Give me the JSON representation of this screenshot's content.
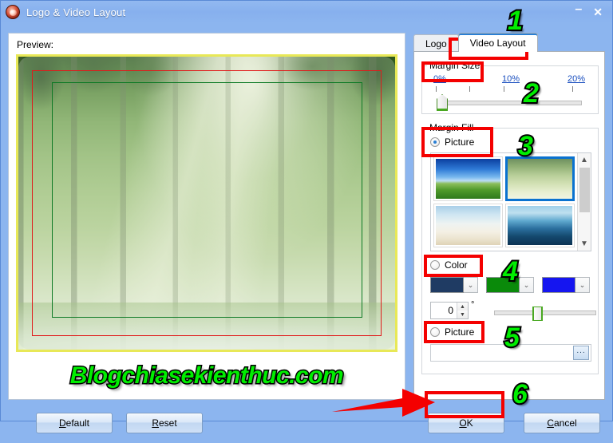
{
  "window": {
    "title": "Logo & Video Layout",
    "icon": "app-icon",
    "minimize_label": "–",
    "close_label": "✕"
  },
  "preview": {
    "label": "Preview:",
    "watermark": "Blogchiasekienthuc.com",
    "border_color": "#e8e857",
    "red_rect_color": "#e01b1b",
    "green_rect_color": "#0d7a25"
  },
  "tabs": [
    {
      "label": "Logo",
      "active": false
    },
    {
      "label": "Video Layout",
      "active": true
    }
  ],
  "margin_size": {
    "legend": "Margin Size",
    "ticks": [
      "0%",
      "10%",
      "20%"
    ],
    "value": "0%"
  },
  "margin_fill": {
    "legend": "Margin Fill",
    "picture_radio_top": {
      "label": "Picture",
      "checked": true
    },
    "thumbnails": [
      {
        "name": "bliss-landscape",
        "selected": false
      },
      {
        "name": "forest-light-rays",
        "selected": true
      },
      {
        "name": "white-beach",
        "selected": false
      },
      {
        "name": "ocean-palm-shadow",
        "selected": false
      }
    ],
    "scrollbar": {
      "up": "▲",
      "down": "▼"
    },
    "color_radio": {
      "label": "Color",
      "checked": false
    },
    "color_swatches": [
      {
        "name": "color-1",
        "hex": "#1f3b63",
        "arrow": "⌄"
      },
      {
        "name": "color-2",
        "hex": "#0a8a0a",
        "arrow": "⌄"
      },
      {
        "name": "color-3",
        "hex": "#1515f0",
        "arrow": "⌄"
      }
    ],
    "angle": {
      "value": "0",
      "unit": "°",
      "up": "▲",
      "down": "▼"
    },
    "gradient_slider_value": 38,
    "picture_radio_bottom": {
      "label": "Picture",
      "checked": false
    },
    "picture_path": "",
    "browse_label": "..."
  },
  "buttons": {
    "default": {
      "accel": "D",
      "rest": "efault"
    },
    "reset": {
      "accel": "R",
      "rest": "eset"
    },
    "ok": {
      "accel": "O",
      "rest": "K"
    },
    "cancel": {
      "accel": "C",
      "rest": "ancel"
    }
  },
  "annotations": {
    "numbers": [
      "1",
      "2",
      "3",
      "4",
      "5",
      "6"
    ],
    "color": "#00ee00",
    "box_color": "#f40000",
    "arrow_color": "#f40000"
  }
}
